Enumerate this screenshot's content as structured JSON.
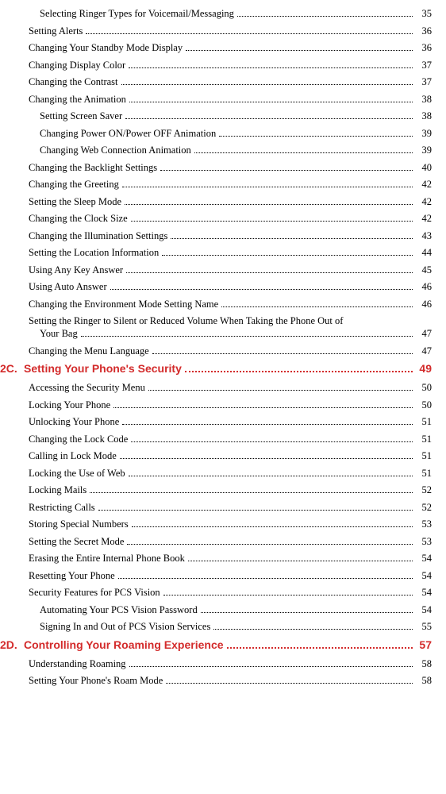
{
  "block1": {
    "items": [
      {
        "level": 3,
        "text": "Selecting Ringer Types for Voicemail/Messaging",
        "page": "35"
      },
      {
        "level": 2,
        "text": "Setting Alerts",
        "page": "36"
      },
      {
        "level": 2,
        "text": "Changing Your Standby Mode Display",
        "page": "36"
      },
      {
        "level": 2,
        "text": "Changing Display Color",
        "page": "37"
      },
      {
        "level": 2,
        "text": "Changing the Contrast",
        "page": "37"
      },
      {
        "level": 2,
        "text": "Changing the Animation",
        "page": "38"
      },
      {
        "level": 3,
        "text": "Setting Screen Saver",
        "page": "38"
      },
      {
        "level": 3,
        "text": "Changing Power ON/Power OFF Animation",
        "page": "39"
      },
      {
        "level": 3,
        "text": "Changing Web Connection Animation",
        "page": "39"
      },
      {
        "level": 2,
        "text": "Changing the Backlight Settings",
        "page": "40"
      },
      {
        "level": 2,
        "text": "Changing the Greeting",
        "page": "42"
      },
      {
        "level": 2,
        "text": "Setting the Sleep Mode",
        "page": "42"
      },
      {
        "level": 2,
        "text": "Changing the Clock Size",
        "page": "42"
      },
      {
        "level": 2,
        "text": "Changing the Illumination Settings",
        "page": "43"
      },
      {
        "level": 2,
        "text": "Setting the Location Information",
        "page": "44"
      },
      {
        "level": 2,
        "text": "Using Any Key Answer",
        "page": "45"
      },
      {
        "level": 2,
        "text": "Using Auto Answer",
        "page": "46"
      },
      {
        "level": 2,
        "text": "Changing the Environment Mode Setting Name",
        "page": "46"
      },
      {
        "level": 2,
        "text": "Setting the Ringer to Silent or Reduced Volume When Taking the Phone Out of",
        "text2": "Your Bag",
        "page": "47",
        "multiline": true
      },
      {
        "level": 2,
        "text": "Changing the Menu Language",
        "page": "47"
      }
    ]
  },
  "section2c": {
    "num": "2C.",
    "title": "Setting Your Phone's Security",
    "page": "49"
  },
  "block2": {
    "items": [
      {
        "level": 2,
        "text": "Accessing the Security Menu",
        "page": "50"
      },
      {
        "level": 2,
        "text": "Locking Your Phone",
        "page": "50"
      },
      {
        "level": 2,
        "text": "Unlocking Your Phone",
        "page": "51"
      },
      {
        "level": 2,
        "text": "Changing the Lock Code",
        "page": "51"
      },
      {
        "level": 2,
        "text": "Calling in Lock Mode",
        "page": "51"
      },
      {
        "level": 2,
        "text": "Locking the Use of Web",
        "page": "51"
      },
      {
        "level": 2,
        "text": "Locking Mails",
        "page": "52"
      },
      {
        "level": 2,
        "text": "Restricting Calls",
        "page": "52"
      },
      {
        "level": 2,
        "text": "Storing Special Numbers",
        "page": "53"
      },
      {
        "level": 2,
        "text": "Setting the Secret Mode",
        "page": "53"
      },
      {
        "level": 2,
        "text": "Erasing the Entire Internal Phone Book",
        "page": "54"
      },
      {
        "level": 2,
        "text": "Resetting Your Phone",
        "page": "54"
      },
      {
        "level": 2,
        "text": "Security Features for PCS Vision",
        "page": "54"
      },
      {
        "level": 3,
        "text": "Automating Your PCS Vision Password",
        "page": "54"
      },
      {
        "level": 3,
        "text": "Signing In and Out of PCS Vision Services",
        "page": "55"
      }
    ]
  },
  "section2d": {
    "num": "2D.",
    "title": "Controlling Your Roaming Experience",
    "page": "57"
  },
  "block3": {
    "items": [
      {
        "level": 2,
        "text": "Understanding Roaming",
        "page": "58"
      },
      {
        "level": 2,
        "text": "Setting Your Phone's Roam Mode",
        "page": "58"
      }
    ]
  }
}
